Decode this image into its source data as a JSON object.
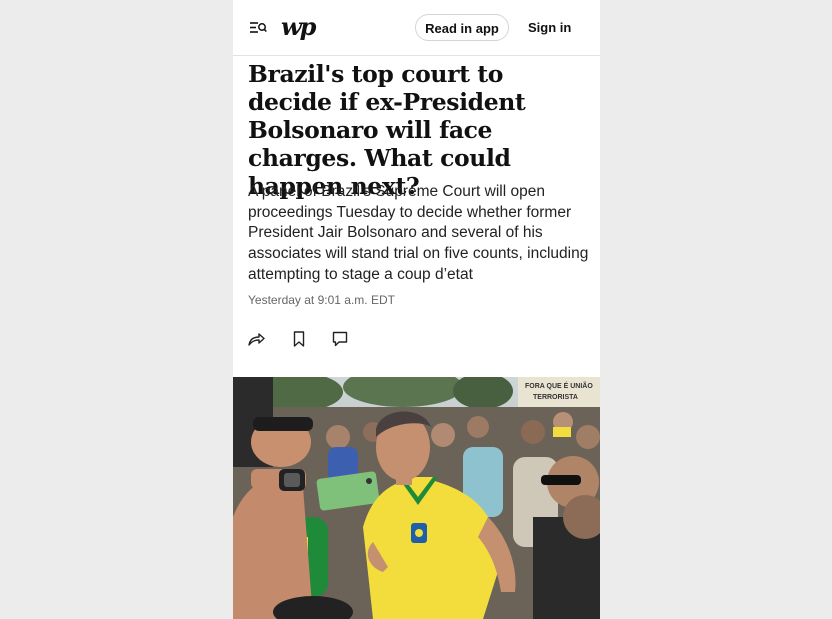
{
  "header": {
    "menu_icon": "menu-search-icon",
    "logo_text": "wp",
    "read_in_app": "Read in app",
    "sign_in": "Sign in"
  },
  "article": {
    "headline": "Brazil's top court to decide if ex-President Bolsonaro will face charges. What could happen next?",
    "dek": "A panel of Brazil’s Supreme Court will open proceedings Tuesday to decide whether former President Jair Bolsonaro and several of his associates will stand trial on five counts, including attempting to stage a coup d’etat",
    "timestamp": "Yesterday at 9:01 a.m. EDT"
  },
  "actions": {
    "share_icon": "share-icon",
    "bookmark_icon": "bookmark-icon",
    "comment_icon": "comment-icon"
  },
  "photo": {
    "description_icon": "news-photo",
    "sign_text": "FORA QUE É UNIÃO TERRORISTA"
  },
  "colors": {
    "background": "#ececec",
    "jersey_yellow": "#f2dd3c",
    "jersey_green": "#1f8a3a"
  }
}
